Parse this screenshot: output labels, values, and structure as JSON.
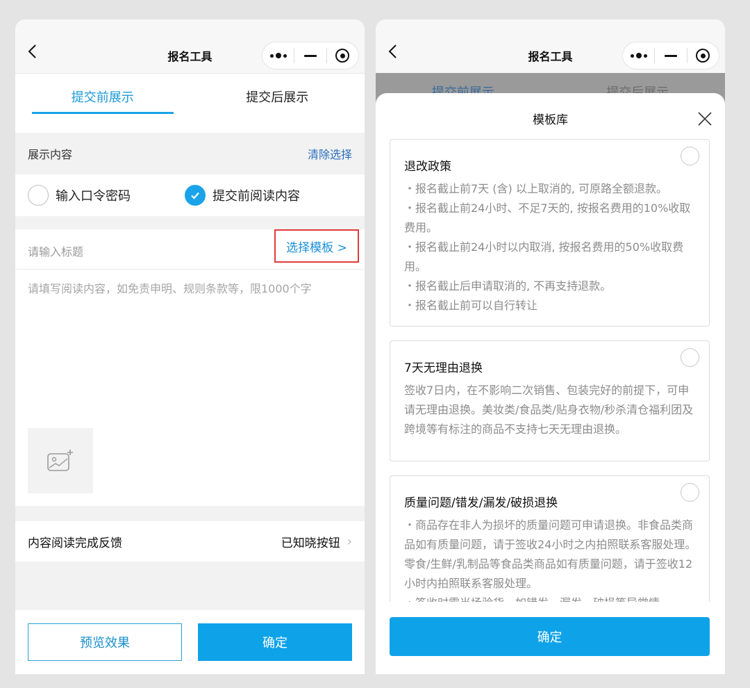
{
  "left": {
    "nav_title": "报名工具",
    "tabs": [
      "提交前展示",
      "提交后展示"
    ],
    "section_label": "展示内容",
    "clear_link": "清除选择",
    "options": [
      "输入口令密码",
      "提交前阅读内容"
    ],
    "title_placeholder": "请输入标题",
    "template_link": "选择模板 >",
    "content_placeholder": "请填写阅读内容，如免责申明、规则条款等，限1000个字",
    "feedback_label": "内容阅读完成反馈",
    "feedback_value": "已知晓按钮",
    "preview_button": "预览效果",
    "confirm_button": "确定"
  },
  "right": {
    "nav_title": "报名工具",
    "dim_tabs": [
      "提交前展示",
      "提交后展示"
    ],
    "sheet_title": "模板库",
    "cards": [
      {
        "title": "退改政策",
        "lines": [
          "・报名截止前7天 (含) 以上取消的, 可原路全额退款。",
          "・报名截止前24小时、不足7天的, 按报名费用的10%收取费用。",
          "・报名截止前24小时以内取消, 按报名费用的50%收取费用。",
          "・报名截止后申请取消的, 不再支持退款。",
          "・报名截止前可以自行转让"
        ]
      },
      {
        "title": "7天无理由退换",
        "lines": [
          "签收7日内，在不影响二次销售、包装完好的前提下，可申请无理由退换。美妆类/食品类/贴身衣物/秒杀清仓福利团及跨境等有标注的商品不支持七天无理由退换。"
        ]
      },
      {
        "title": "质量问题/错发/漏发/破损退换",
        "lines": [
          "・商品存在非人为损坏的质量问题可申请退换。非食品类商品如有质量问题，请于签收24小时之内拍照联系客服处理。零食/生鲜/乳制品等食品类商品如有质量问题，请于签收12小时内拍照联系客服处理。",
          "・签收时需当场验货，如错发、漏发、破损等异常情"
        ]
      }
    ],
    "confirm_button": "确定"
  }
}
